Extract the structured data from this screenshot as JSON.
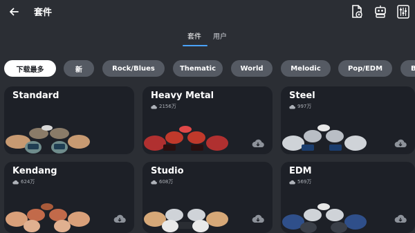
{
  "header": {
    "title": "套件",
    "icons": [
      "back-arrow-icon",
      "import-file-icon",
      "robot-icon",
      "mixer-icon"
    ]
  },
  "tabs": [
    {
      "label": "套件",
      "active": true
    },
    {
      "label": "用户",
      "active": false
    }
  ],
  "categories": [
    {
      "label": "下载最多",
      "active": true
    },
    {
      "label": "新"
    },
    {
      "label": "Rock/Blues"
    },
    {
      "label": "Thematic"
    },
    {
      "label": "World"
    },
    {
      "label": "Melodic"
    },
    {
      "label": "Pop/EDM"
    },
    {
      "label": "B"
    }
  ],
  "kits": [
    {
      "name": "Standard",
      "downloads": ""
    },
    {
      "name": "Heavy Metal",
      "downloads": "2156万"
    },
    {
      "name": "Steel",
      "downloads": "997万"
    },
    {
      "name": "Kendang",
      "downloads": "624万"
    },
    {
      "name": "Studio",
      "downloads": "608万"
    },
    {
      "name": "EDM",
      "downloads": "569万"
    }
  ],
  "colors": {
    "background": "#2b2e34",
    "card": "#1d2027",
    "chip": "#555a63",
    "accent": "#4aa3ff"
  }
}
